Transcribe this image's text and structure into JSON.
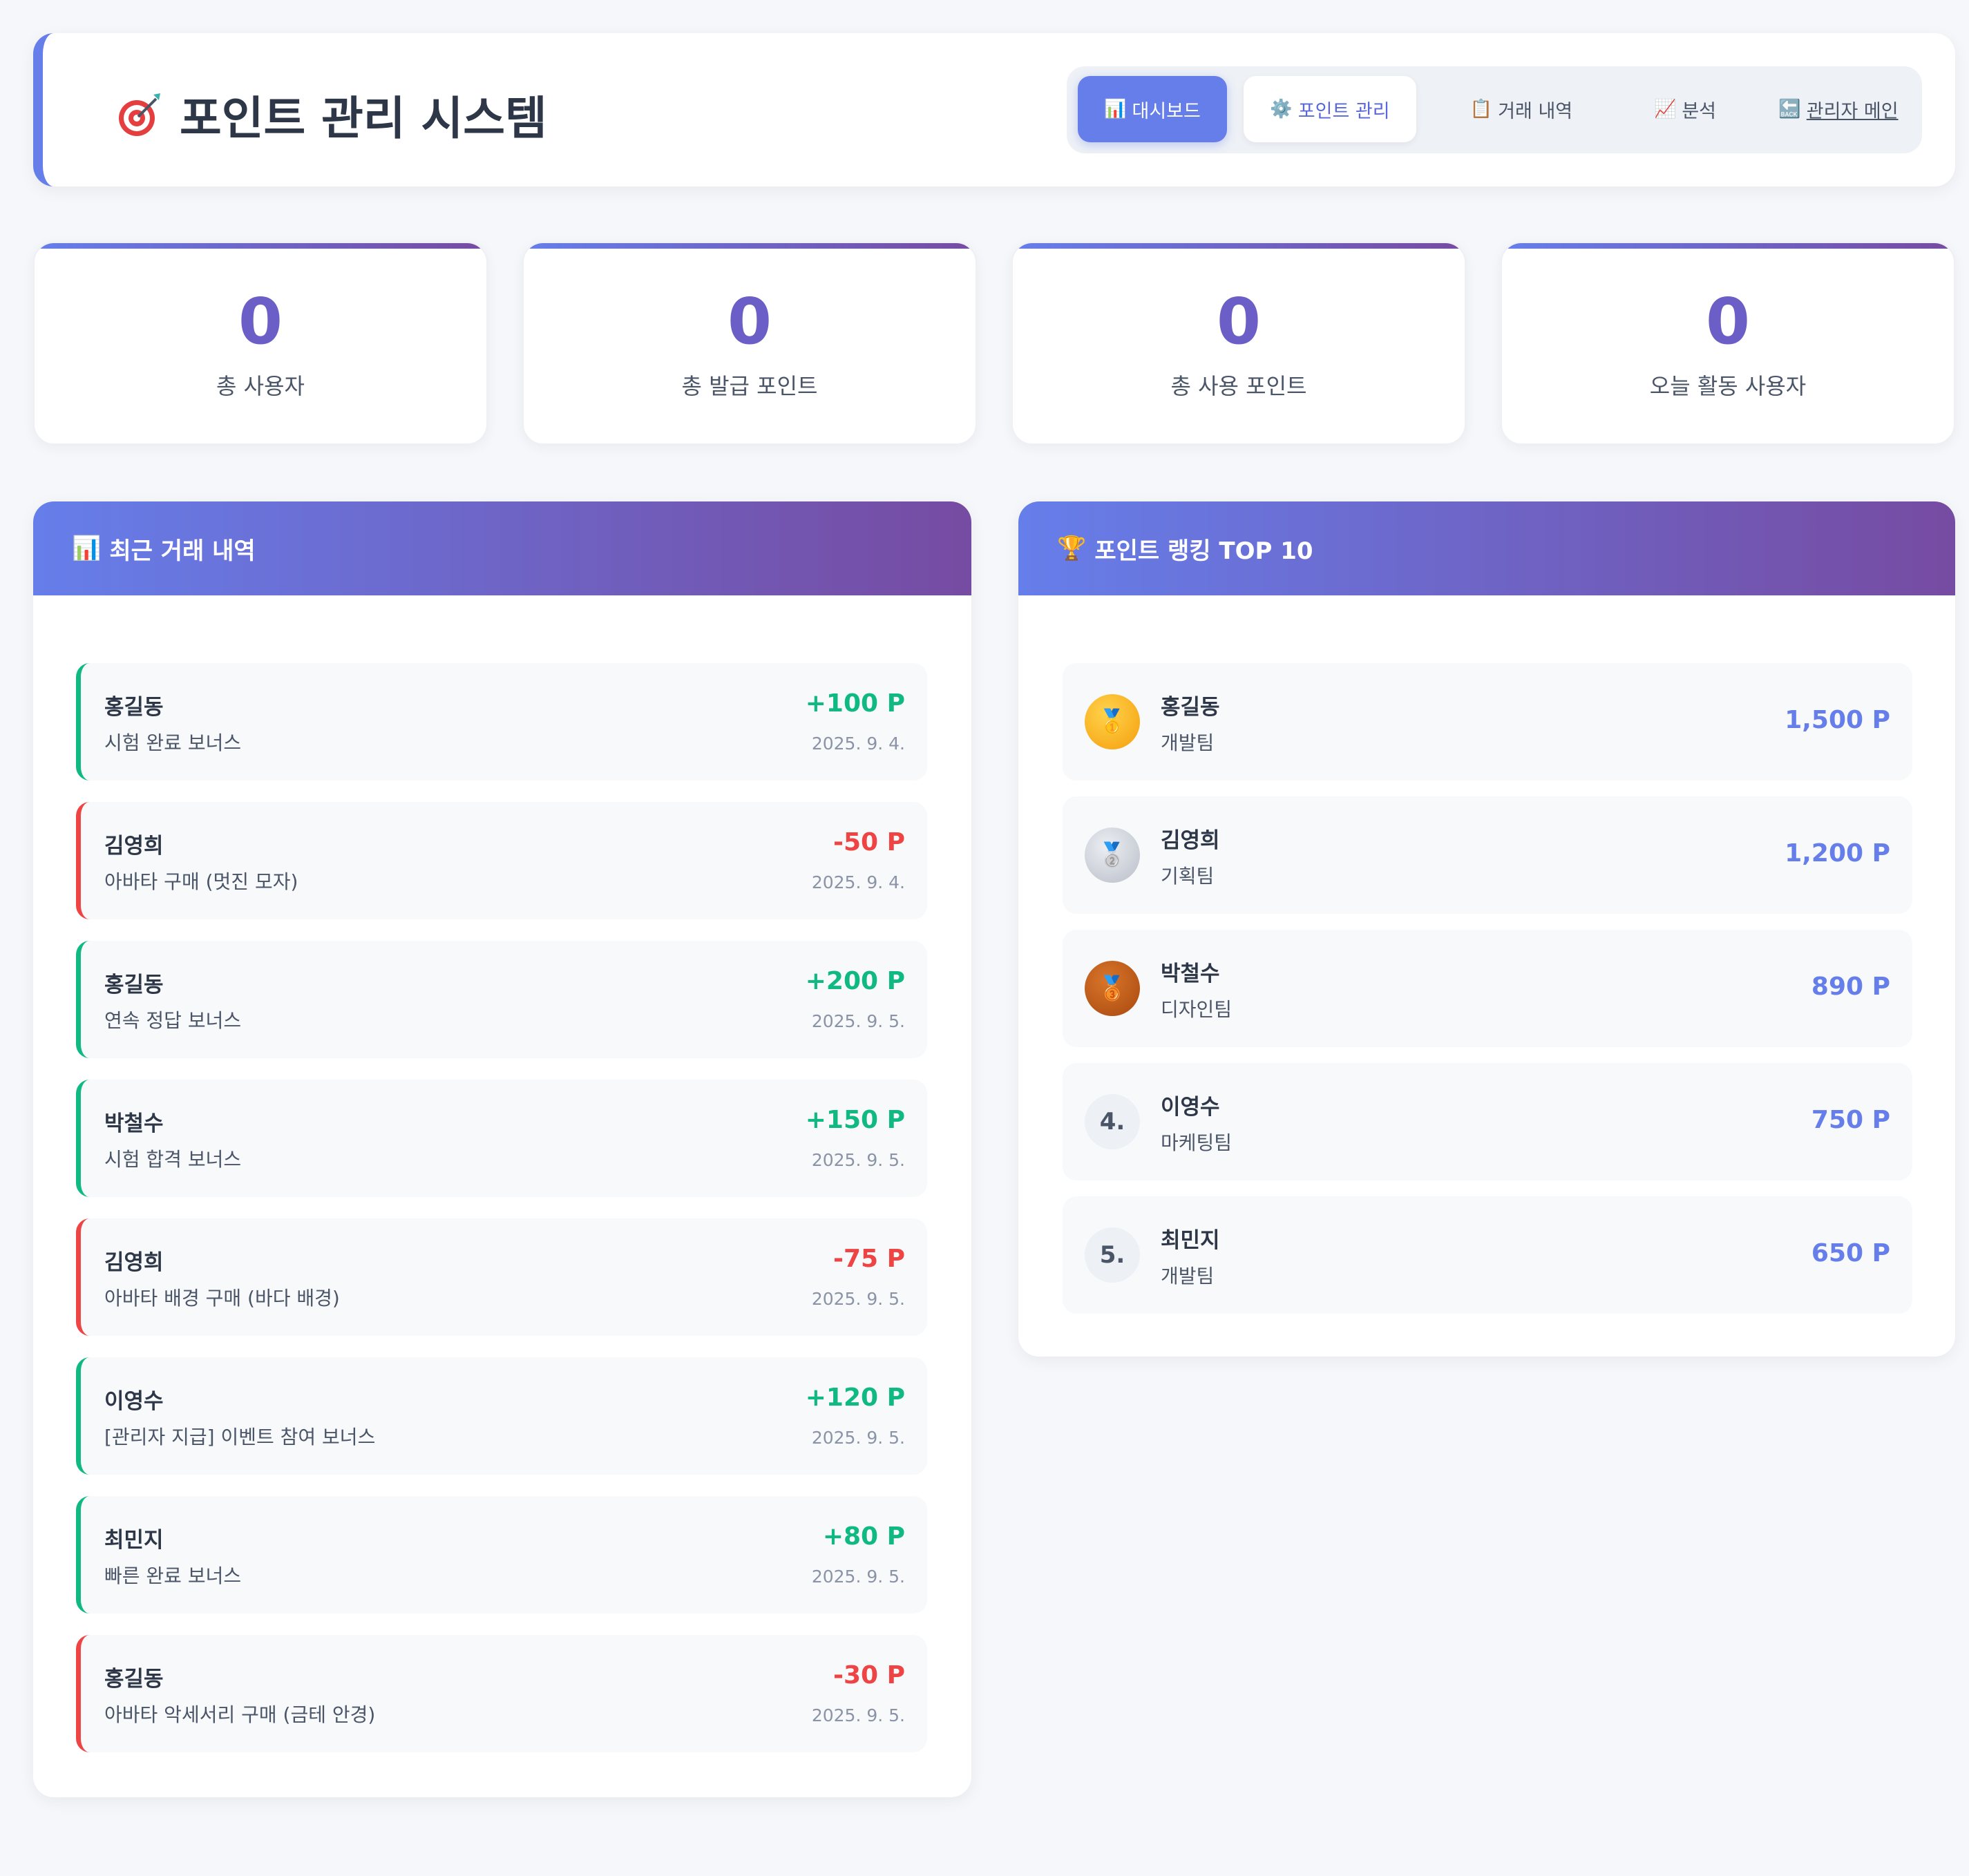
{
  "header": {
    "title": "포인트 관리 시스템",
    "nav": [
      {
        "icon": "📊",
        "label": "대시보드"
      },
      {
        "icon": "⚙️",
        "label": "포인트 관리"
      },
      {
        "icon": "📋",
        "label": "거래 내역"
      },
      {
        "icon": "📈",
        "label": "분석"
      },
      {
        "icon": "🔙",
        "label": "관리자 메인"
      }
    ]
  },
  "stats": [
    {
      "value": "0",
      "label": "총 사용자"
    },
    {
      "value": "0",
      "label": "총 발급 포인트"
    },
    {
      "value": "0",
      "label": "총 사용 포인트"
    },
    {
      "value": "0",
      "label": "오늘 활동 사용자"
    }
  ],
  "transactions_panel": {
    "icon": "📊",
    "title": "최근 거래 내역",
    "items": [
      {
        "name": "홍길동",
        "desc": "시험 완료 보너스",
        "amount": "+100 P",
        "date": "2025. 9. 4."
      },
      {
        "name": "김영희",
        "desc": "아바타 구매 (멋진 모자)",
        "amount": "-50 P",
        "date": "2025. 9. 4."
      },
      {
        "name": "홍길동",
        "desc": "연속 정답 보너스",
        "amount": "+200 P",
        "date": "2025. 9. 5."
      },
      {
        "name": "박철수",
        "desc": "시험 합격 보너스",
        "amount": "+150 P",
        "date": "2025. 9. 5."
      },
      {
        "name": "김영희",
        "desc": "아바타 배경 구매 (바다 배경)",
        "amount": "-75 P",
        "date": "2025. 9. 5."
      },
      {
        "name": "이영수",
        "desc": "[관리자 지급] 이벤트 참여 보너스",
        "amount": "+120 P",
        "date": "2025. 9. 5."
      },
      {
        "name": "최민지",
        "desc": "빠른 완료 보너스",
        "amount": "+80 P",
        "date": "2025. 9. 5."
      },
      {
        "name": "홍길동",
        "desc": "아바타 악세서리 구매 (금테 안경)",
        "amount": "-30 P",
        "date": "2025. 9. 5."
      }
    ]
  },
  "ranking_panel": {
    "icon": "🏆",
    "title": "포인트 랭킹 TOP 10",
    "items": [
      {
        "rank": "🥇",
        "name": "홍길동",
        "team": "개발팀",
        "points": "1,500 P"
      },
      {
        "rank": "🥈",
        "name": "김영희",
        "team": "기획팀",
        "points": "1,200 P"
      },
      {
        "rank": "🥉",
        "name": "박철수",
        "team": "디자인팀",
        "points": "890 P"
      },
      {
        "rank": "4.",
        "name": "이영수",
        "team": "마케팅팀",
        "points": "750 P"
      },
      {
        "rank": "5.",
        "name": "최민지",
        "team": "개발팀",
        "points": "650 P"
      }
    ]
  },
  "colors": {
    "accent": "#667eea",
    "accent_end": "#764ba2",
    "positive": "#10b981",
    "negative": "#ef4444",
    "stat_value": "#6b5fc7"
  }
}
